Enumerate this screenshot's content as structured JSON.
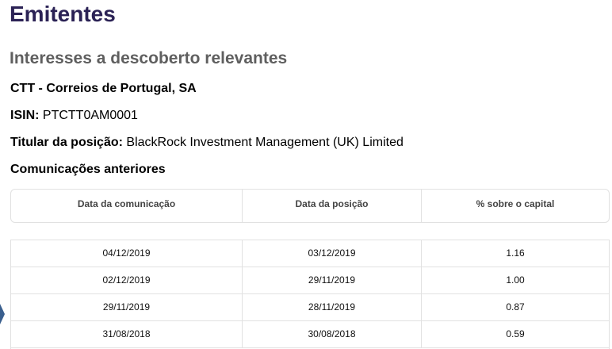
{
  "page": {
    "title": "Emitentes",
    "subtitle": "Interesses a descoberto relevantes",
    "company": "CTT - Correios de Portugal, SA",
    "isin_label": "ISIN:",
    "isin_value": "PTCTT0AM0001",
    "holder_label": "Titular da posição:",
    "holder_value": "BlackRock Investment Management (UK) Limited",
    "previous_label": "Comunicações anteriores"
  },
  "table": {
    "headers": [
      "Data da comunicação",
      "Data da posição",
      "% sobre o capital"
    ],
    "rows": [
      [
        "04/12/2019",
        "03/12/2019",
        "1.16"
      ],
      [
        "02/12/2019",
        "29/11/2019",
        "1.00"
      ],
      [
        "29/11/2019",
        "28/11/2019",
        "0.87"
      ],
      [
        "31/08/2018",
        "30/08/2018",
        "0.59"
      ]
    ]
  },
  "colors": {
    "title": "#2b2255",
    "subtitle": "#5f5f5f",
    "border": "#e1e1e1",
    "side_arrow": "#3a5f8e"
  },
  "icons": {
    "side_arrow": "chevron-right-icon"
  }
}
